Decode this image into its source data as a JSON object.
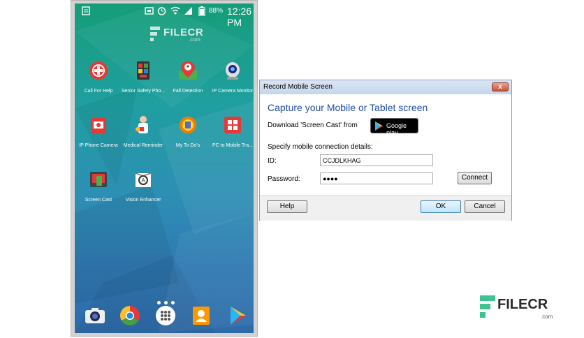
{
  "phone": {
    "status_bar": {
      "battery": "88%",
      "time": "12:26 PM"
    },
    "watermark": "FILECR",
    "watermark_sub": ".com",
    "apps": [
      {
        "label": "Call For Help",
        "icon": "call-for-help-icon"
      },
      {
        "label": "Senior Safety Pho...",
        "icon": "senior-safety-phone-icon"
      },
      {
        "label": "Fall Detection",
        "icon": "fall-detection-icon"
      },
      {
        "label": "IP Camera Monitor",
        "icon": "ip-camera-monitor-icon"
      },
      {
        "label": "IP Phone Camera",
        "icon": "ip-phone-camera-icon"
      },
      {
        "label": "Medical Reminder",
        "icon": "medical-reminder-icon"
      },
      {
        "label": "My To Do's",
        "icon": "my-to-dos-icon"
      },
      {
        "label": "PC to Mobile Tra...",
        "icon": "pc-to-mobile-icon"
      },
      {
        "label": "Screen Cast",
        "icon": "screen-cast-icon"
      },
      {
        "label": "Vision Enhancer",
        "icon": "vision-enhancer-icon"
      }
    ],
    "dock": [
      "camera-icon",
      "chrome-icon",
      "apps-drawer-icon",
      "contacts-icon",
      "play-store-icon"
    ]
  },
  "dialog": {
    "title": "Record Mobile Screen",
    "close_label": "x",
    "heading": "Capture your Mobile or Tablet screen",
    "download_label": "Download 'Screen Cast' from",
    "google_play_label": "Google play",
    "spec_label": "Specify mobile connection details:",
    "id_label": "ID:",
    "id_value": "CCJDLKHAG",
    "password_label": "Password:",
    "password_value": "●●●●",
    "connect_label": "Connect",
    "help_label": "Help",
    "ok_label": "OK",
    "cancel_label": "Cancel"
  },
  "watermark": {
    "text": "FILECR",
    "sub": ".com"
  },
  "colors": {
    "accent": "#1f4fa6",
    "watermark_green": "#3cc38f"
  }
}
